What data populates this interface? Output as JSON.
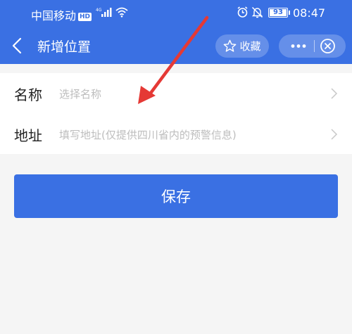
{
  "status_bar": {
    "carrier": "中国移动",
    "hd_badge": "HD",
    "battery_level": "93",
    "time": "08:47",
    "icons": [
      "signal-icon",
      "wifi-icon",
      "alarm-icon",
      "mute-icon",
      "battery-icon"
    ]
  },
  "nav": {
    "title": "新增位置",
    "favorite_label": "收藏",
    "icons": [
      "back-icon",
      "star-icon",
      "more-icon",
      "close-icon"
    ]
  },
  "form": {
    "name": {
      "label": "名称",
      "placeholder": "选择名称"
    },
    "address": {
      "label": "地址",
      "placeholder": "填写地址(仅提供四川省内的预警信息)"
    }
  },
  "actions": {
    "save_label": "保存"
  },
  "colors": {
    "primary": "#3a70e3",
    "background": "#f5f5f5",
    "placeholder_text": "#bdbdbd",
    "annotation_arrow": "#e53935"
  }
}
